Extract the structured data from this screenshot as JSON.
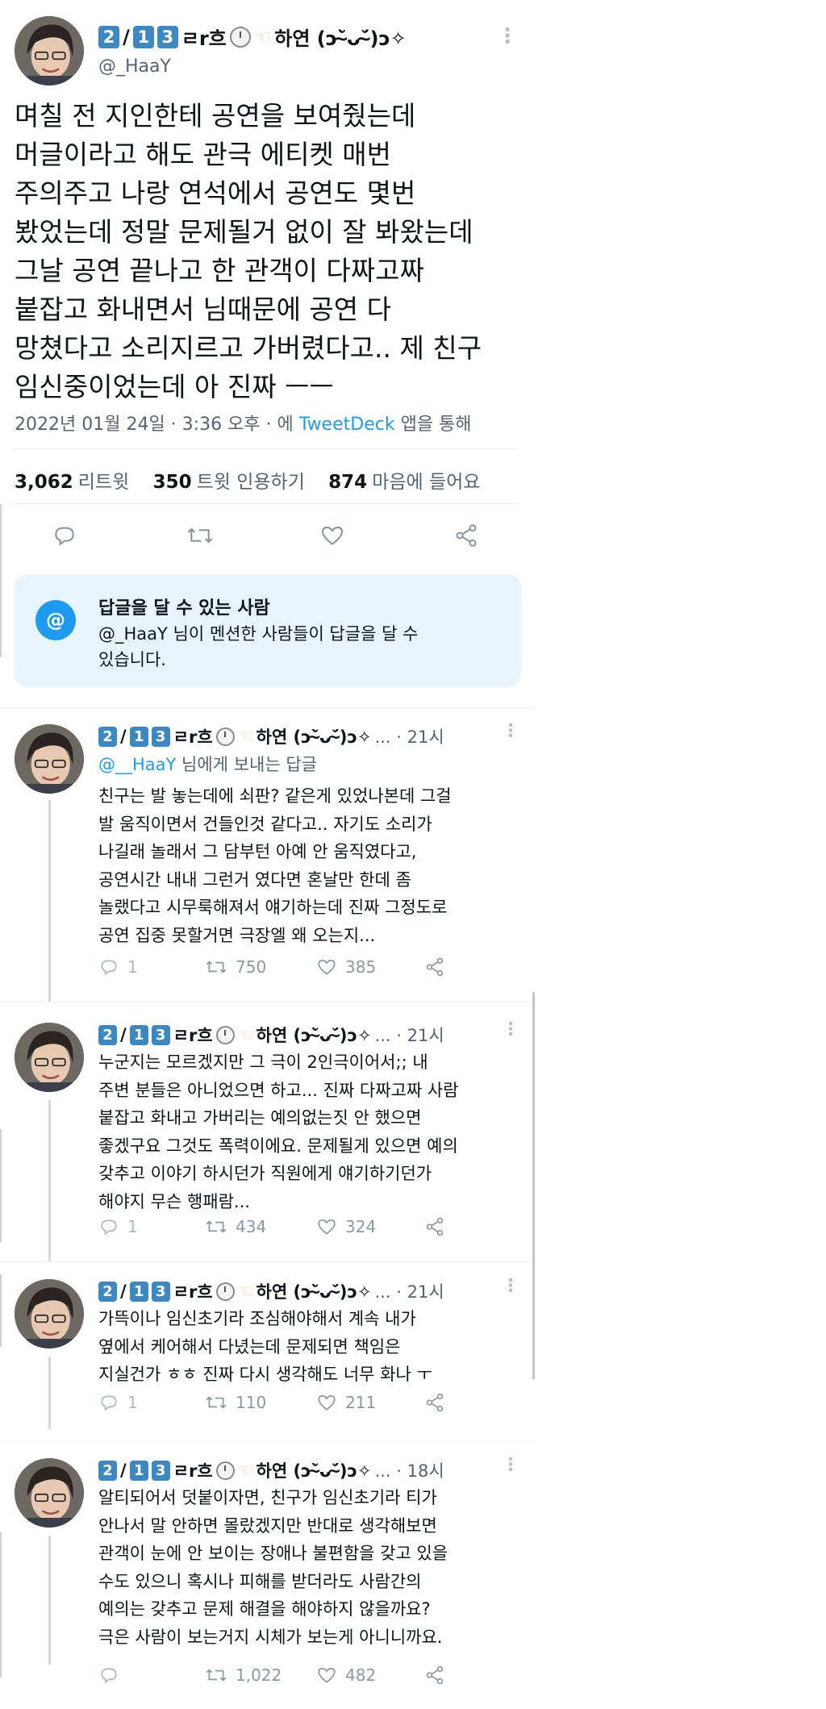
{
  "main_tweet": {
    "display_name": "하연 (ɔ˘̴̀ᴗ˘̴́)ɔ✧",
    "badge_nums": [
      "2",
      "1",
      "3"
    ],
    "name_extra": "ㄹr흐",
    "handle": "@_HaaY",
    "text_lines": [
      "며칠 전 지인한테 공연을 보여줬는데",
      "머글이라고 해도 관극 에티켓 매번",
      "주의주고 나랑 연석에서 공연도 몇번",
      "봤었는데 정말 문제될거 없이 잘 봐왔는데",
      "그날 공연 끝나고 한 관객이 다짜고짜",
      "붙잡고 화내면서 님때문에 공연 다",
      "망쳤다고 소리지르고 가버렸다고.. 제 친구",
      "임신중이었는데 아 진짜 ㅡㅡ"
    ],
    "meta_date": "2022년 01월 24일 · 3:36 오후 · 에",
    "meta_app": "TweetDeck",
    "meta_suffix": "앱을 통해",
    "retweets": "3,062",
    "retweets_label": "리트윗",
    "quotes": "350",
    "quotes_label": "트윗 인용하기",
    "likes": "874",
    "likes_label": "마음에 들어요"
  },
  "reply_notice": {
    "icon": "@",
    "title": "답글을 달 수 있는 사람",
    "line1": "@_HaaY 님이 멘션한 사람들이 답글을 달 수",
    "line2": "있습니다."
  },
  "replies": [
    {
      "time": "... · 21시",
      "reply_to_handle": "@__HaaY",
      "reply_to_suffix": "님에게 보내는 답글",
      "lines": [
        "친구는 발 놓는데에 쇠판? 같은게 있었나본데 그걸",
        "발 움직이면서 건들인것 같다고.. 자기도 소리가",
        "나길래 놀래서 그 담부턴 아예 안 움직였다고,",
        "공연시간 내내 그런거 였다면 혼날만 한데 좀",
        "놀랬다고 시무룩해져서 얘기하는데 진짜 그정도로",
        "공연 집중 못할거면 극장엘 왜 오는지..."
      ],
      "reply_count": "1",
      "retweets": "750",
      "likes": "385"
    },
    {
      "time": "... · 21시",
      "lines": [
        "누군지는 모르겠지만 그 극이 2인극이어서;; 내",
        "주변 분들은 아니었으면 하고... 진짜 다짜고짜 사람",
        "붙잡고 화내고 가버리는 예의없는짓 안 했으면",
        "좋겠구요 그것도 폭력이에요. 문제될게 있으면 예의",
        "갖추고 이야기 하시던가 직원에게 얘기하기던가",
        "해야지 무슨 행패람..."
      ],
      "reply_count": "1",
      "retweets": "434",
      "likes": "324"
    },
    {
      "time": "... · 21시",
      "lines": [
        "가뜩이나 임신초기라 조심해야해서 계속 내가",
        "옆에서 케어해서 다녔는데 문제되면 책임은",
        "지실건가 ㅎㅎ 진짜 다시 생각해도 너무 화나 ㅜ"
      ],
      "reply_count": "1",
      "retweets": "110",
      "likes": "211"
    },
    {
      "time": "... · 18시",
      "lines": [
        "알티되어서 덧붙이자면, 친구가 임신초기라 티가",
        "안나서 말 안하면 몰랐겠지만 반대로 생각해보면",
        "관객이 눈에 안 보이는 장애나 불편함을 갖고 있을",
        "수도 있으니 혹시나 피해를 받더라도 사람간의",
        "예의는 갖추고 문제 해결을 해야하지 않을까요?",
        "극은 사람이 보는거지 시체가 보는게 아니니까요."
      ],
      "reply_count": "",
      "retweets": "1,022",
      "likes": "482"
    }
  ],
  "icons": {
    "more": "more-vertical-icon",
    "reply": "reply-icon",
    "retweet": "retweet-icon",
    "like": "heart-icon",
    "share": "share-icon"
  },
  "colors": {
    "link": "#1d9bf0",
    "muted": "#536471",
    "notice_bg": "#e8f5fd",
    "badge": "#3b88c3"
  }
}
